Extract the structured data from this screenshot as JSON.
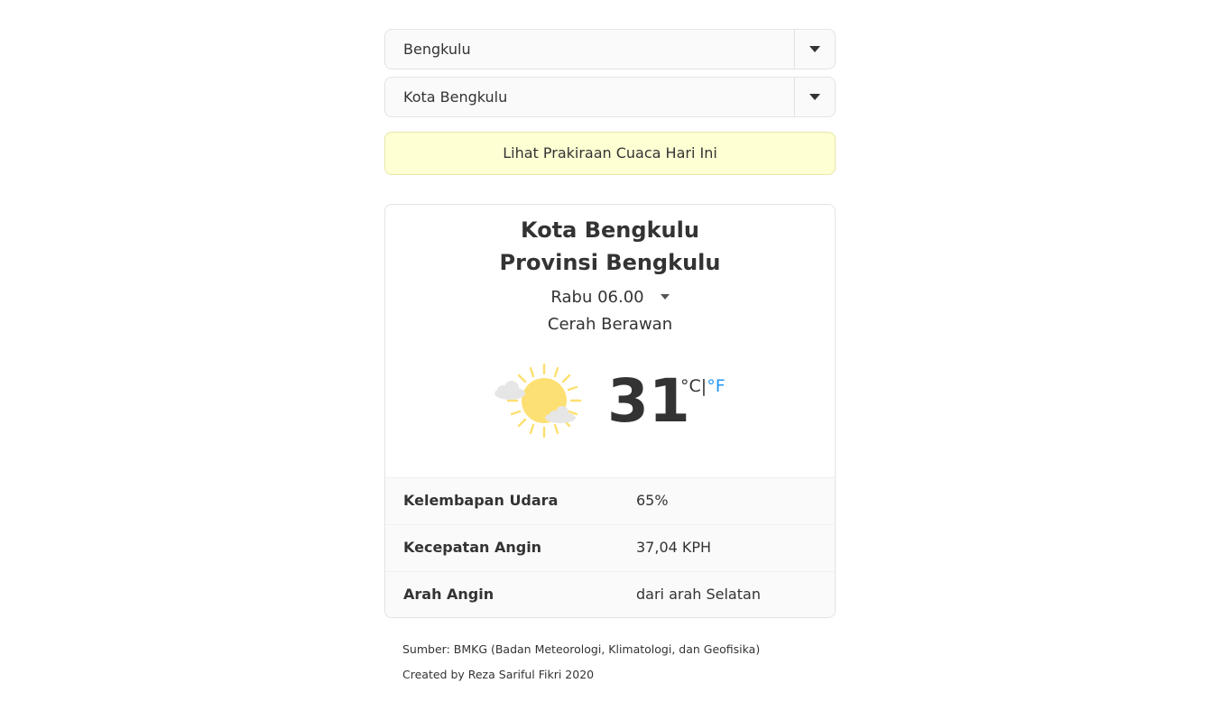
{
  "selectors": {
    "province": "Bengkulu",
    "city": "Kota Bengkulu"
  },
  "forecast_button": "Lihat Prakiraan Cuaca Hari Ini",
  "weather": {
    "city": "Kota Bengkulu",
    "province": "Provinsi Bengkulu",
    "time": "Rabu 06.00",
    "condition": "Cerah Berawan",
    "icon": "sun-behind-clouds-icon",
    "temperature": "31",
    "unit_c": "°C",
    "unit_separator": "|",
    "unit_f": "°F",
    "active_unit_color": "#333333",
    "link_unit_color": "#2196f3"
  },
  "details": [
    {
      "label": "Kelembapan Udara",
      "value": "65%"
    },
    {
      "label": "Kecepatan Angin",
      "value": "37,04 KPH"
    },
    {
      "label": "Arah Angin",
      "value": "dari arah Selatan"
    }
  ],
  "footer": {
    "source": "Sumber: BMKG (Badan Meteorologi, Klimatologi, dan Geofisika)",
    "credit": "Created by Reza Sariful Fikri 2020"
  },
  "colors": {
    "button_bg": "#ffffd4",
    "sun": "#fde073"
  }
}
